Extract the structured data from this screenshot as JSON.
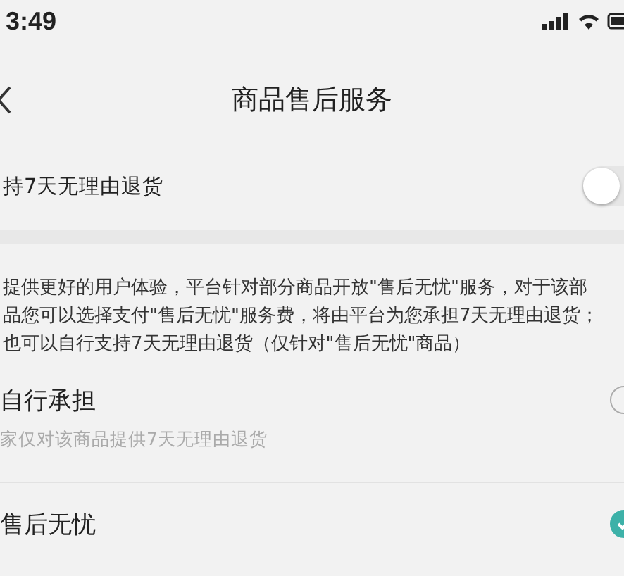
{
  "status_bar": {
    "time": "3:49"
  },
  "nav": {
    "title": "商品售后服务"
  },
  "return_toggle": {
    "label": "持7天无理由退货",
    "on": false
  },
  "description_lines": [
    "提供更好的用户体验，平台针对部分商品开放\"售后无忧\"服务，对于该部",
    "品您可以选择支付\"售后无忧\"服务费，将由平台为您承担7天无理由退货；",
    "也可以自行支持7天无理由退货（仅针对\"售后无忧\"商品）"
  ],
  "options": [
    {
      "title": "自行承担",
      "subtitle": "家仅对该商品提供7天无理由退货",
      "selected": false
    },
    {
      "title": "售后无忧",
      "selected": true
    }
  ]
}
